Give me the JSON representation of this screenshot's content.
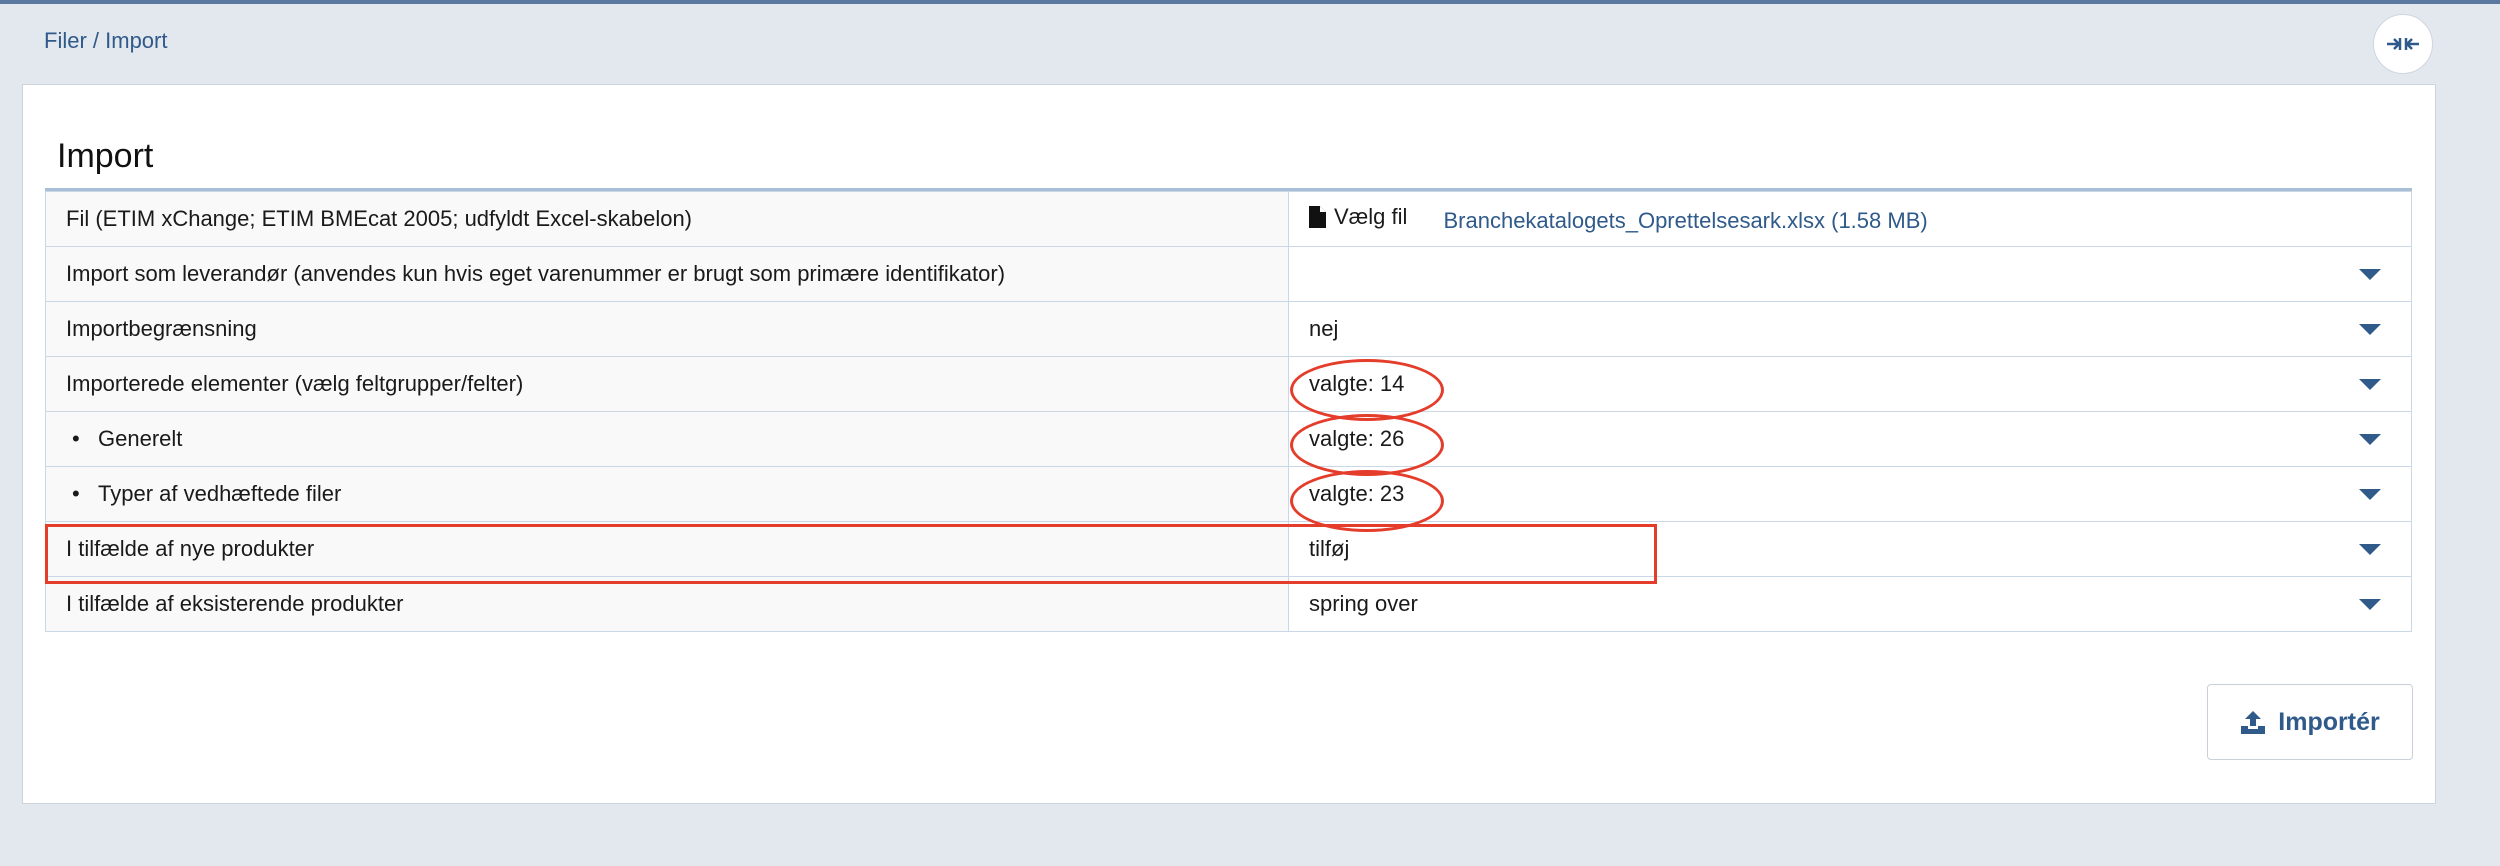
{
  "breadcrumb": {
    "parent": "Filer",
    "separator": " / ",
    "current": "Import"
  },
  "panel": {
    "title": "Import"
  },
  "rows": [
    {
      "label": "Fil (ETIM xChange; ETIM BMEcat 2005; udfyldt Excel-skabelon)",
      "choose_label": "Vælg fil",
      "file_name": "Branchekatalogets_Oprettelsesark.xlsx (1.58 MB)"
    },
    {
      "label": "Import som leverandør (anvendes kun hvis eget varenummer er brugt som primære identifikator)",
      "value": ""
    },
    {
      "label": "Importbegrænsning",
      "value": "nej"
    },
    {
      "label": "Importerede elementer (vælg feltgrupper/felter)",
      "value": "valgte: 14"
    },
    {
      "label": "Generelt",
      "bullet": "•",
      "value": "valgte: 26"
    },
    {
      "label": "Typer af vedhæftede filer",
      "bullet": "•",
      "value": "valgte: 23"
    },
    {
      "label": "I tilfælde af nye produkter",
      "value": "tilføj"
    },
    {
      "label": "I tilfælde af eksisterende produkter",
      "value": "spring over"
    }
  ],
  "import_button": {
    "label": "Importér",
    "icon": "upload-icon"
  },
  "collapse_button": {
    "icon": "collapse-arrows-icon"
  },
  "annotation_color": "#e43d2b",
  "accent_color": "#2f5a8a"
}
